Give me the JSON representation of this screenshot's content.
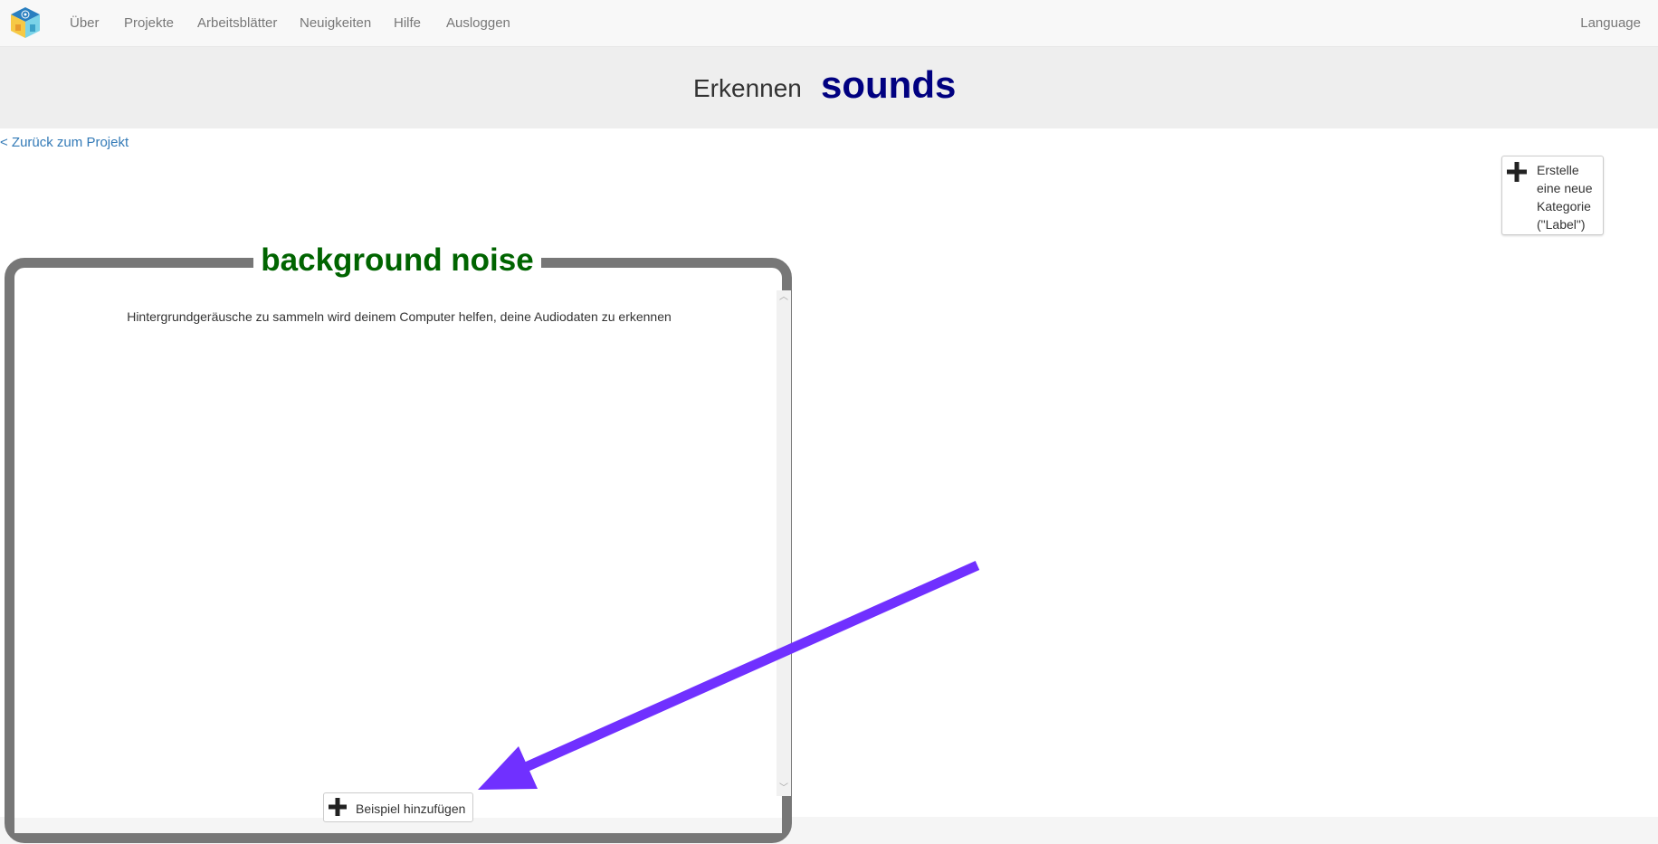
{
  "navbar": {
    "logo_icon": "ml-cube-logo-icon",
    "items": [
      {
        "label": "Über"
      },
      {
        "label": "Projekte"
      },
      {
        "label": "Arbeitsblätter"
      },
      {
        "label": "Neuigkeiten"
      },
      {
        "label": "Hilfe"
      },
      {
        "label": "Ausloggen"
      }
    ],
    "language_label": "Language"
  },
  "header": {
    "prefix": "Erkennen",
    "project_name": "sounds",
    "project_name_color": "#000080"
  },
  "back_link": {
    "label": "< Zurück zum Projekt"
  },
  "new_label_button": {
    "icon": "plus-icon",
    "label": "Erstelle eine neue Kategorie (\"Label\")"
  },
  "label_panel": {
    "title": "background noise",
    "title_color": "#006400",
    "description": "Hintergrundgeräusche zu sammeln wird deinem Computer helfen, deine Audiodaten zu erkennen",
    "add_example_label": "Beispiel hinzufügen",
    "add_example_icon": "plus-icon"
  },
  "annotation": {
    "arrow_color": "#7030ff"
  }
}
